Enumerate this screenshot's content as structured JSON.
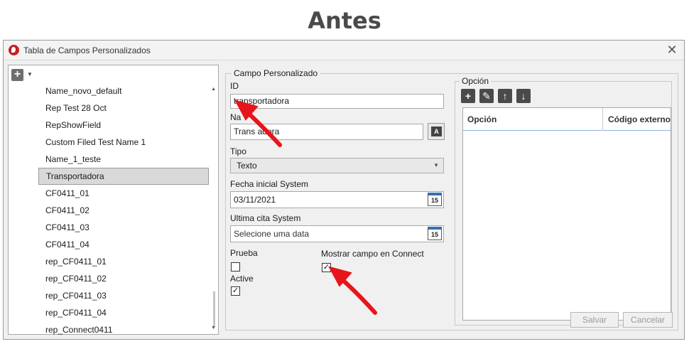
{
  "heading": "Antes",
  "window": {
    "title": "Tabla de Campos Personalizados"
  },
  "list": {
    "items": [
      "Name_novo_default",
      "Rep Test 28 Oct",
      "RepShowField",
      "Custom Filed Test Name 1",
      "Name_1_teste",
      "Transportadora",
      "CF0411_01",
      "CF0411_02",
      "CF0411_03",
      "CF0411_04",
      "rep_CF0411_01",
      "rep_CF0411_02",
      "rep_CF0411_03",
      "rep_CF0411_04",
      "rep_Connect0411"
    ],
    "selected_index": 5
  },
  "form": {
    "group_title": "Campo Personalizado",
    "id_label": "ID",
    "id_value": "transportadora",
    "name_label": "Na",
    "name_value": "Trans          adora",
    "tipo_label": "Tipo",
    "tipo_value": "Texto",
    "fecha_label": "Fecha inicial System",
    "fecha_value": "03/11/2021",
    "ultima_label": "Ultima cita System",
    "ultima_placeholder": "Selecione uma data",
    "calendar_day": "15",
    "prueba_label": "Prueba",
    "prueba_checked": false,
    "active_label": "Active",
    "active_checked": true,
    "mostrar_label": "Mostrar campo en Connect",
    "mostrar_checked": true,
    "check_glyph": "✓"
  },
  "opcion": {
    "group_title": "Opción",
    "columns": [
      "Opción",
      "Código externo"
    ]
  },
  "buttons": {
    "save": "Salvar",
    "cancel": "Cancelar"
  },
  "colors": {
    "annotation_arrow": "#e8141b",
    "app_icon": "#c8201f"
  }
}
